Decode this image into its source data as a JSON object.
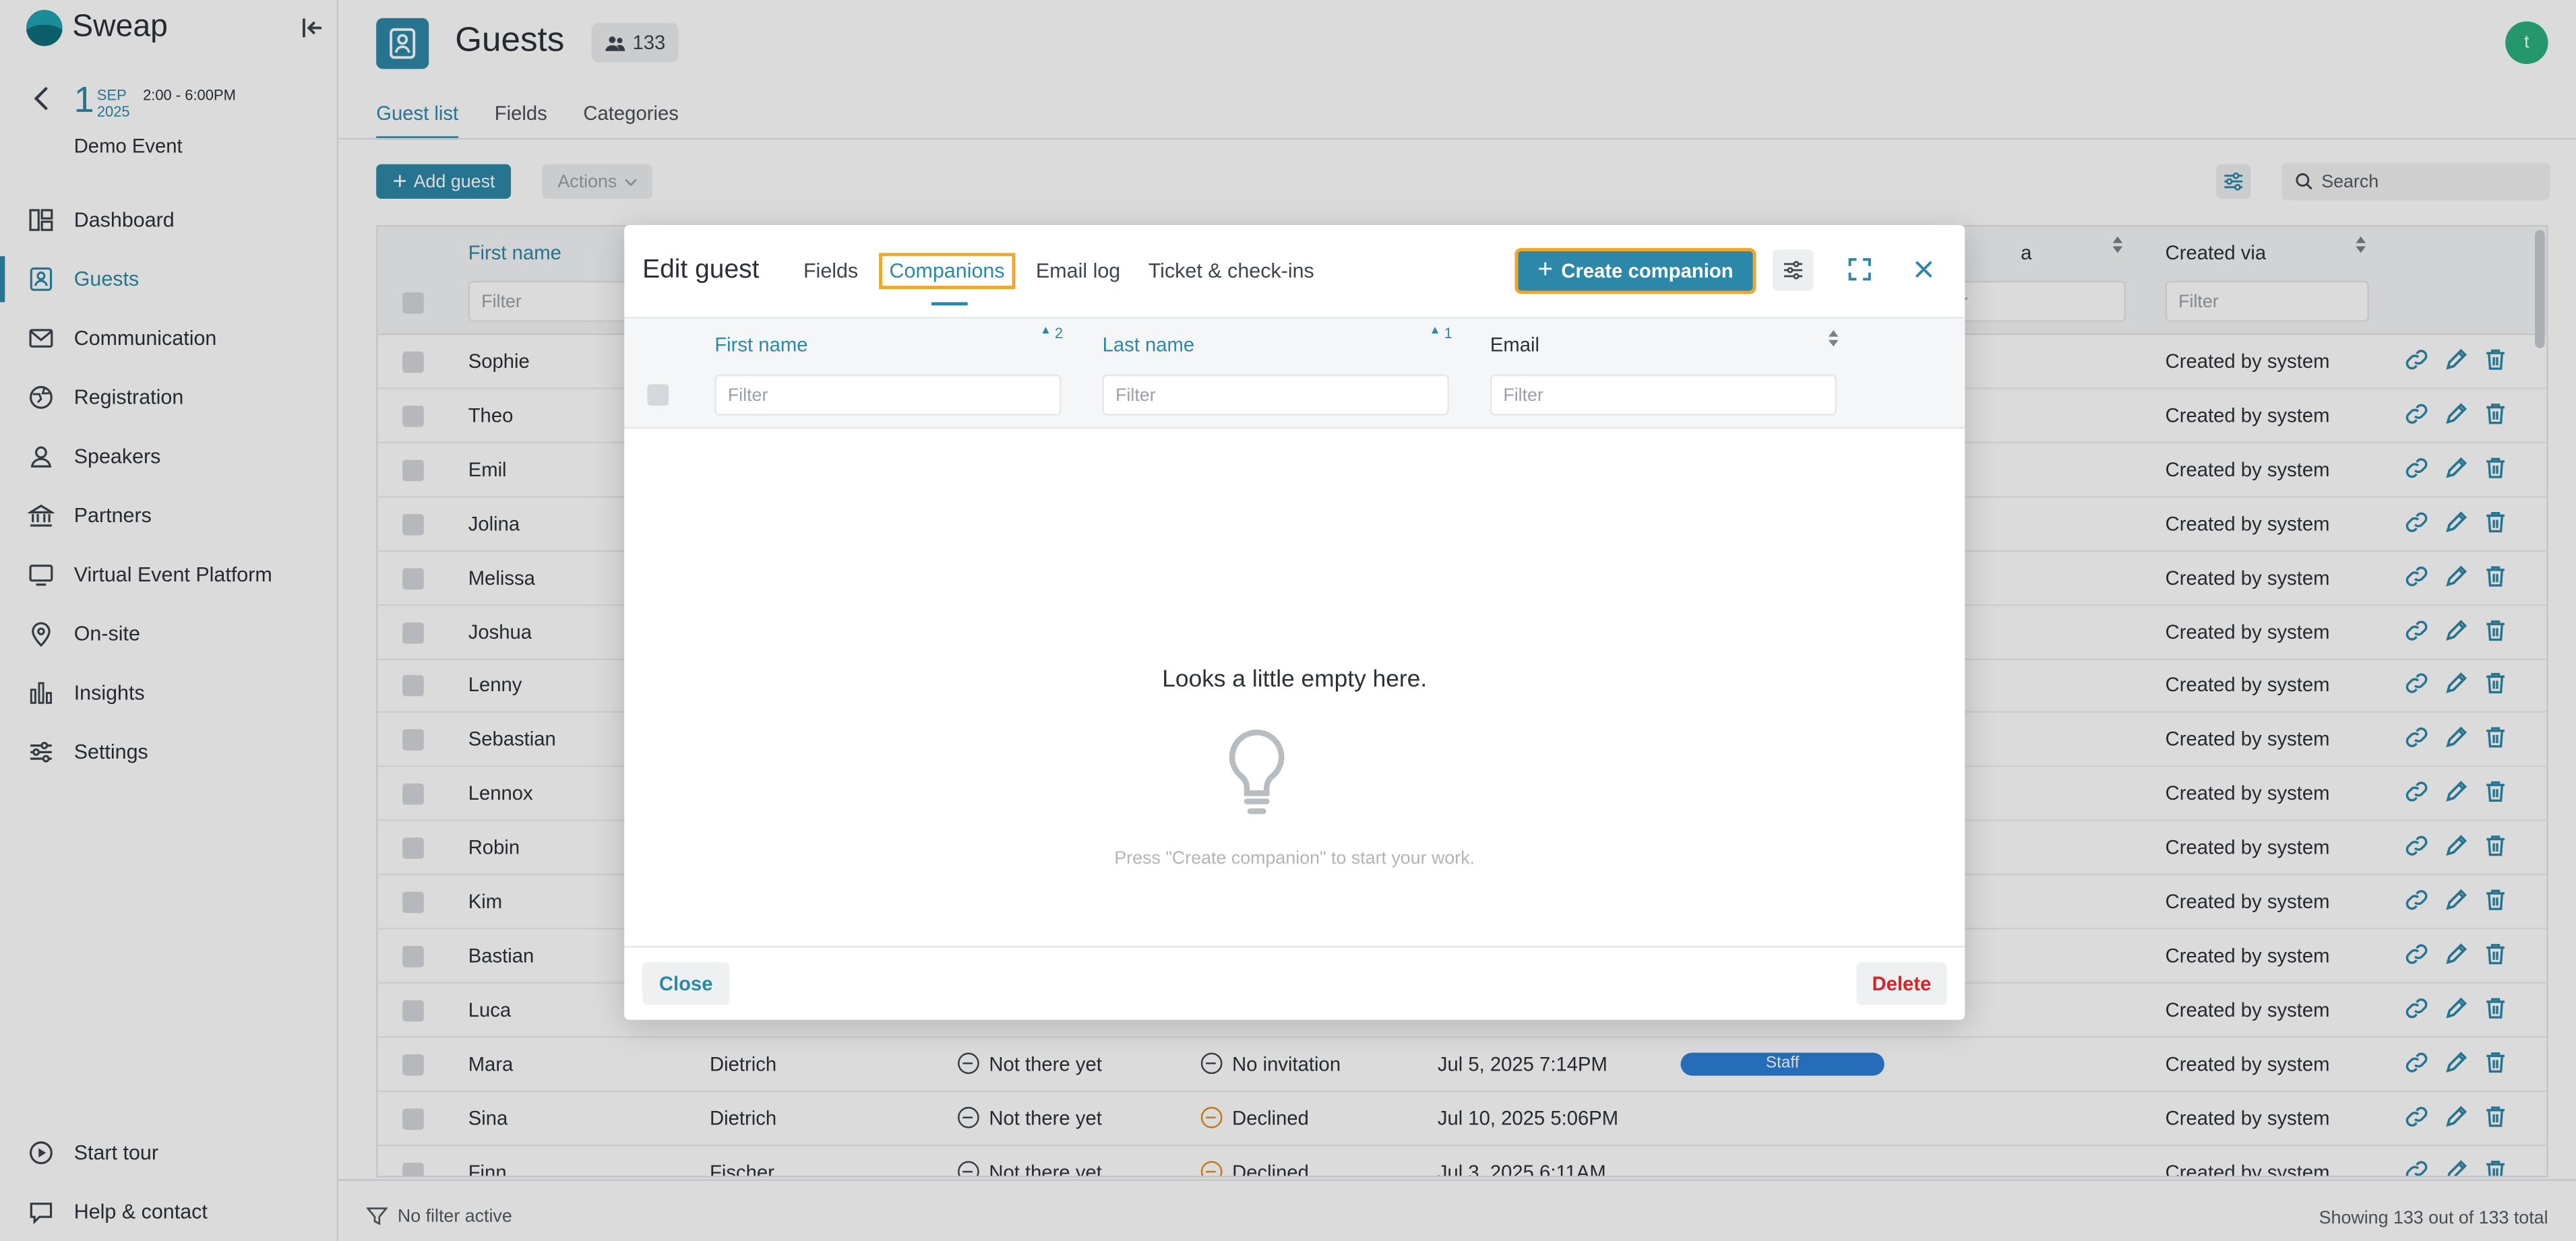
{
  "app": {
    "name": "Sweap"
  },
  "event": {
    "day": "1",
    "month": "SEP",
    "year": "2025",
    "time": "2:00 - 6:00PM",
    "name": "Demo Event"
  },
  "sidebar": {
    "items": [
      {
        "label": "Dashboard",
        "icon": "dashboard-icon"
      },
      {
        "label": "Guests",
        "icon": "guests-icon",
        "active": true
      },
      {
        "label": "Communication",
        "icon": "mail-icon"
      },
      {
        "label": "Registration",
        "icon": "globe-icon"
      },
      {
        "label": "Speakers",
        "icon": "speaker-icon"
      },
      {
        "label": "Partners",
        "icon": "bank-icon"
      },
      {
        "label": "Virtual Event Platform",
        "icon": "screen-icon"
      },
      {
        "label": "On-site",
        "icon": "pin-icon"
      },
      {
        "label": "Insights",
        "icon": "bar-chart-icon"
      },
      {
        "label": "Settings",
        "icon": "sliders-icon"
      }
    ],
    "bottom": [
      {
        "label": "Start tour",
        "icon": "play-icon"
      },
      {
        "label": "Help & contact",
        "icon": "chat-icon"
      }
    ]
  },
  "header": {
    "title": "Guests",
    "count": "133",
    "avatar": "t"
  },
  "tabs": [
    "Guest list",
    "Fields",
    "Categories"
  ],
  "toolbar": {
    "add_label": "Add guest",
    "actions_label": "Actions",
    "search_placeholder": "Search"
  },
  "table": {
    "columns": {
      "first_name": "First name",
      "created_via": "Created via",
      "partial": "a",
      "filter": "Filter",
      "filter_partial": "er"
    },
    "rows": [
      {
        "first": "Sophie",
        "last": "",
        "checkin": "",
        "invite": "",
        "date": "",
        "cat": "",
        "via": "Created by system"
      },
      {
        "first": "Theo",
        "last": "",
        "checkin": "",
        "invite": "",
        "date": "",
        "cat": "",
        "via": "Created by system"
      },
      {
        "first": "Emil",
        "last": "",
        "checkin": "",
        "invite": "",
        "date": "",
        "cat": "",
        "via": "Created by system"
      },
      {
        "first": "Jolina",
        "last": "",
        "checkin": "",
        "invite": "",
        "date": "",
        "cat": "",
        "via": "Created by system"
      },
      {
        "first": "Melissa",
        "last": "",
        "checkin": "",
        "invite": "",
        "date": "",
        "cat": "",
        "via": "Created by system"
      },
      {
        "first": "Joshua",
        "last": "",
        "checkin": "",
        "invite": "",
        "date": "",
        "cat": "",
        "via": "Created by system"
      },
      {
        "first": "Lenny",
        "last": "",
        "checkin": "",
        "invite": "",
        "date": "",
        "cat": "",
        "via": "Created by system"
      },
      {
        "first": "Sebastian",
        "last": "",
        "checkin": "",
        "invite": "",
        "date": "",
        "cat": "",
        "via": "Created by system"
      },
      {
        "first": "Lennox",
        "last": "",
        "checkin": "",
        "invite": "",
        "date": "",
        "cat": "",
        "via": "Created by system"
      },
      {
        "first": "Robin",
        "last": "",
        "checkin": "",
        "invite": "",
        "date": "",
        "cat": "",
        "via": "Created by system"
      },
      {
        "first": "Kim",
        "last": "",
        "checkin": "",
        "invite": "",
        "date": "",
        "cat": "",
        "via": "Created by system"
      },
      {
        "first": "Bastian",
        "last": "",
        "checkin": "",
        "invite": "",
        "date": "",
        "cat": "",
        "via": "Created by system"
      },
      {
        "first": "Luca",
        "last": "",
        "checkin": "",
        "invite": "",
        "date": "",
        "cat": "",
        "via": "Created by system"
      },
      {
        "first": "Mara",
        "last": "Dietrich",
        "checkin": "Not there yet",
        "invite": "No invitation",
        "invite_color": "gray",
        "date": "Jul 5, 2025 7:14PM",
        "cat": "Staff",
        "via": "Created by system"
      },
      {
        "first": "Sina",
        "last": "Dietrich",
        "checkin": "Not there yet",
        "invite": "Declined",
        "invite_color": "orange",
        "date": "Jul 10, 2025 5:06PM",
        "cat": "",
        "via": "Created by system"
      },
      {
        "first": "Finn",
        "last": "Fischer",
        "checkin": "Not there yet",
        "invite": "Declined",
        "invite_color": "orange",
        "date": "Jul 3, 2025 6:11AM",
        "cat": "",
        "via": "Created by system"
      }
    ]
  },
  "footer": {
    "filter_status": "No filter active",
    "showing": "Showing 133 out of 133 total"
  },
  "modal": {
    "title": "Edit guest",
    "tabs": [
      "Fields",
      "Companions",
      "Email log",
      "Ticket & check-ins"
    ],
    "create_label": "Create companion",
    "columns": {
      "first_name": "First name",
      "first_sort": "2",
      "last_name": "Last name",
      "last_sort": "1",
      "email": "Email",
      "filter": "Filter"
    },
    "empty_title": "Looks a little empty here.",
    "empty_hint": "Press \"Create companion\" to start your work.",
    "close_label": "Close",
    "delete_label": "Delete"
  },
  "colors": {
    "accent": "#2d87a8",
    "highlight": "#f3a72a",
    "danger": "#d0252b",
    "staff": "#2d7fd8"
  }
}
